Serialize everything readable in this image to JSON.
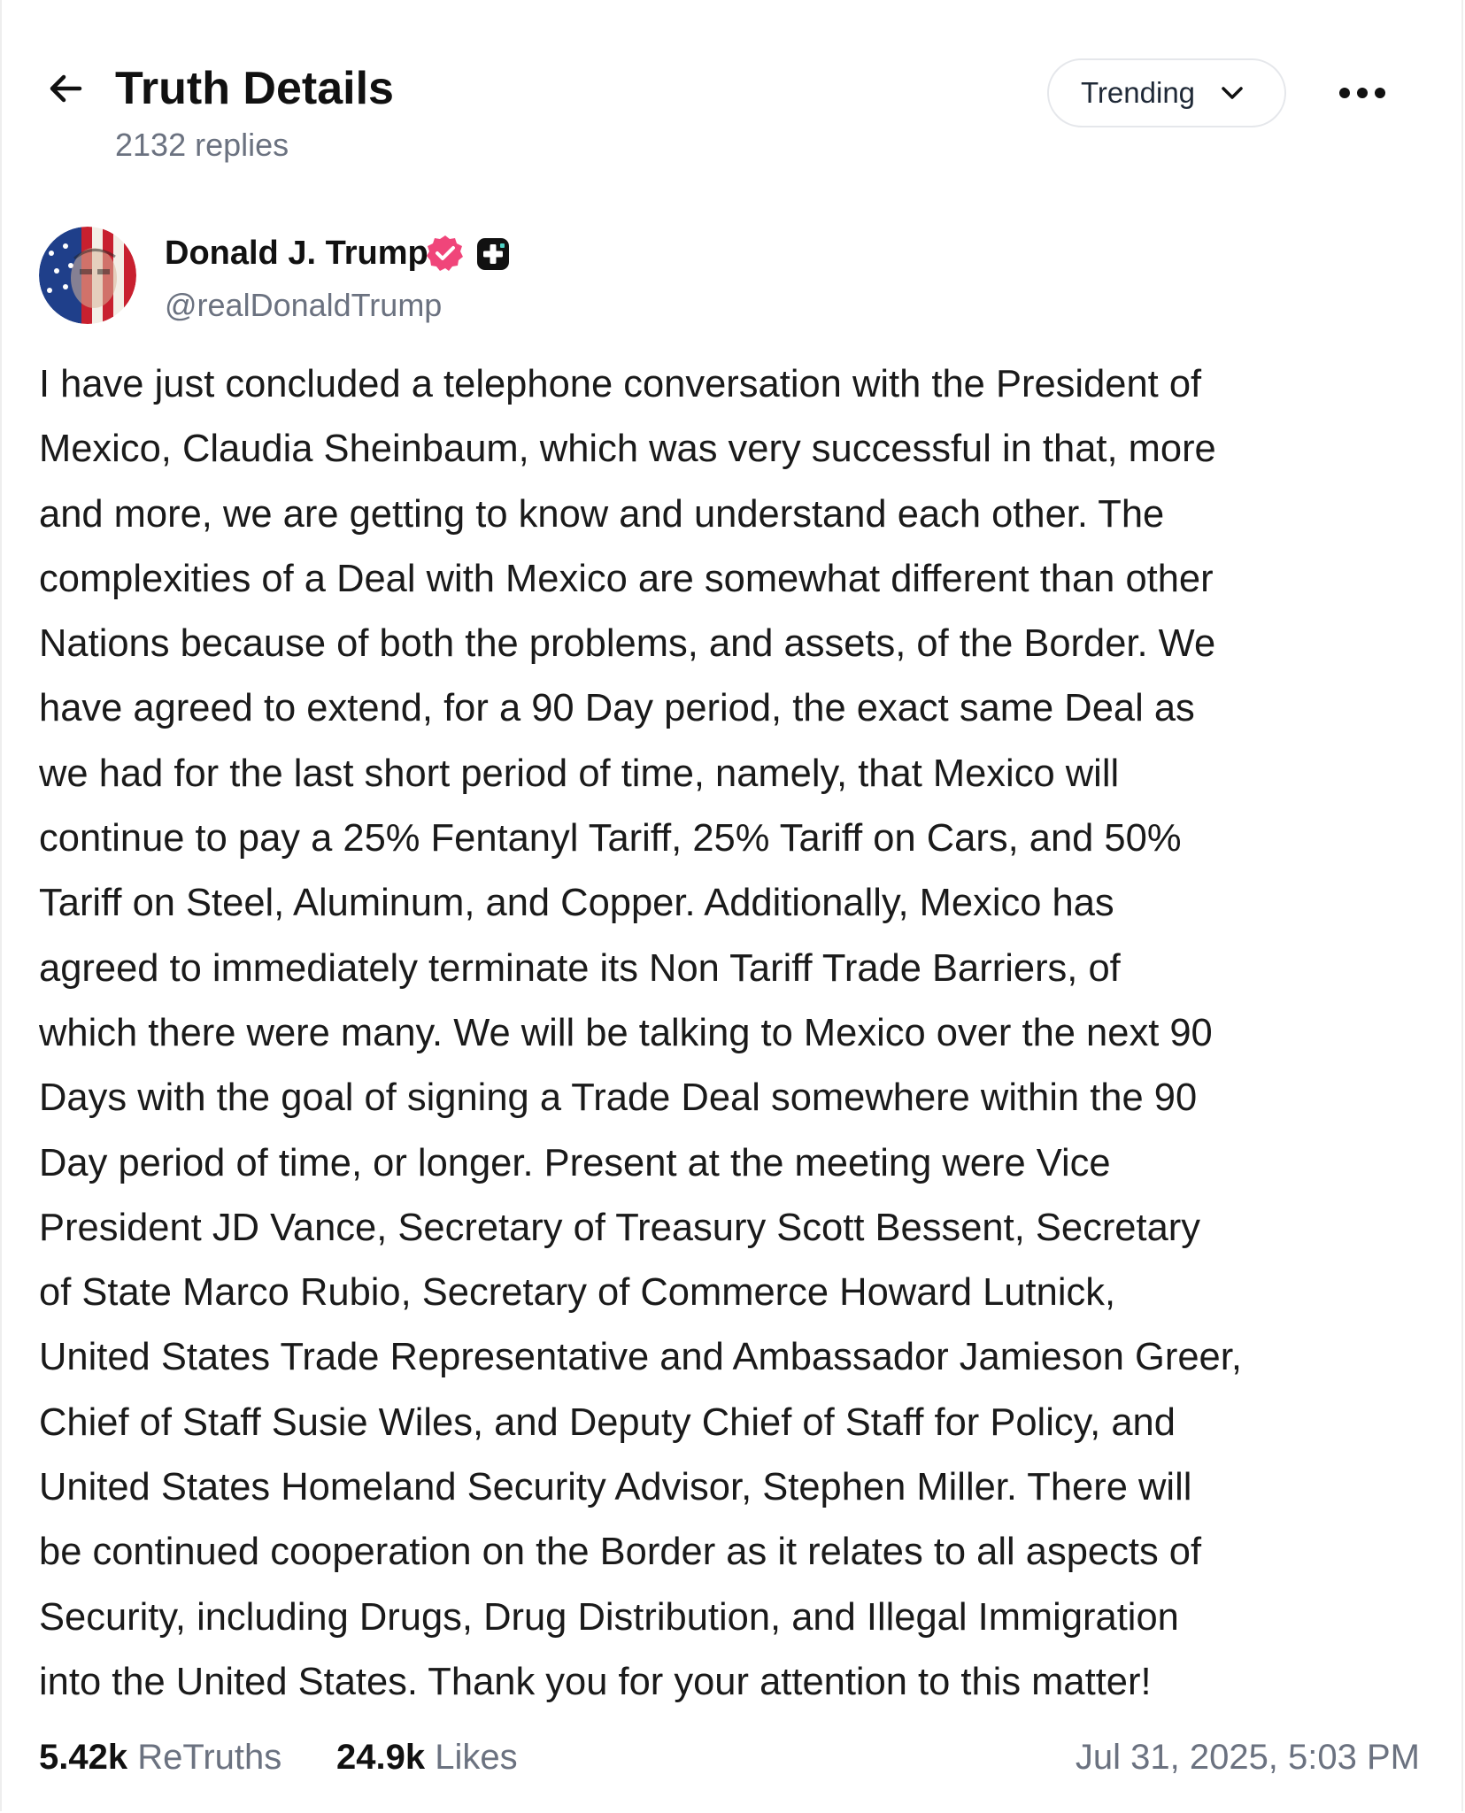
{
  "header": {
    "title": "Truth Details",
    "reply_count": "2132 replies",
    "sort_dropdown": {
      "selected": "Trending"
    },
    "icons": {
      "back": "arrow-left-icon",
      "dropdown": "chevron-down-icon",
      "more": "more-horizontal-icon"
    }
  },
  "author": {
    "display_name": "Donald J. Trump",
    "handle": "@realDonaldTrump",
    "verified_color": "#f0457a",
    "icons": {
      "verified": "verified-badge-icon",
      "plus": "plus-badge-icon"
    }
  },
  "post": {
    "lines": [
      "I have just concluded a telephone conversation with the President of",
      "Mexico, Claudia Sheinbaum, which was very successful in that, more",
      "and more, we are getting to know and understand each other. The",
      "complexities of a Deal with Mexico are somewhat different than other",
      "Nations because of both the problems, and assets, of the Border. We",
      "have agreed to extend, for a 90 Day period, the exact same Deal as",
      "we had for the last short period of time, namely, that Mexico will",
      "continue to pay a 25% Fentanyl Tariff, 25% Tariff on Cars, and 50%",
      "Tariff on Steel, Aluminum, and Copper. Additionally, Mexico has",
      "agreed to immediately terminate its Non Tariff Trade Barriers, of",
      "which there were many. We will be talking to Mexico over the next 90",
      "Days with the goal of signing a Trade Deal somewhere within the 90",
      "Day period of time, or longer. Present at the meeting were Vice",
      "President JD Vance, Secretary of Treasury Scott Bessent, Secretary",
      "of State Marco Rubio, Secretary of Commerce Howard Lutnick,",
      "United States Trade Representative and Ambassador Jamieson Greer,",
      "Chief of Staff Susie Wiles, and Deputy Chief of Staff for Policy, and",
      "United States Homeland Security Advisor, Stephen Miller. There will",
      "be continued cooperation on the Border as it relates to all aspects of",
      "Security, including Drugs, Drug Distribution, and Illegal Immigration",
      "into the United States. Thank you for your attention to this matter!"
    ]
  },
  "stats": {
    "retruths_value": "5.42k",
    "retruths_label": "ReTruths",
    "likes_value": "24.9k",
    "likes_label": "Likes",
    "timestamp": "Jul 31, 2025, 5:03 PM"
  },
  "colors": {
    "text_primary": "#111111",
    "text_secondary": "#6b7280",
    "border": "#e5e7eb",
    "verified_badge": "#f0457a"
  }
}
